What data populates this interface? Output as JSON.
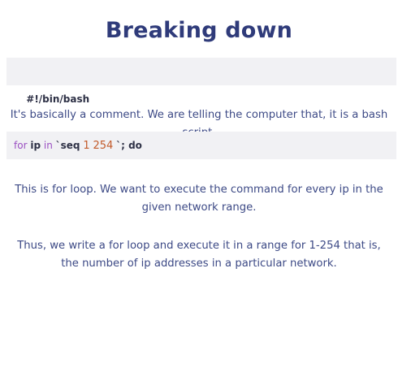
{
  "heading": "Breaking down",
  "code_line_1": "#!/bin/bash",
  "explanation_1": "It's basically a comment. We are telling the computer that, it is a bash script.",
  "code_line_2": {
    "kw_for": "for",
    "var": "ip",
    "kw_in": "in",
    "backtick_open": "`",
    "cmd": "seq",
    "arg1": "1",
    "arg2": "254",
    "backtick_close": "`",
    "tail": "; do"
  },
  "explanation_2": "This is for loop. We want to execute the command for every ip in the given network range.",
  "explanation_3": "Thus, we write a for loop and execute it in a range for 1-254 that is, the number of ip addresses in a particular network."
}
